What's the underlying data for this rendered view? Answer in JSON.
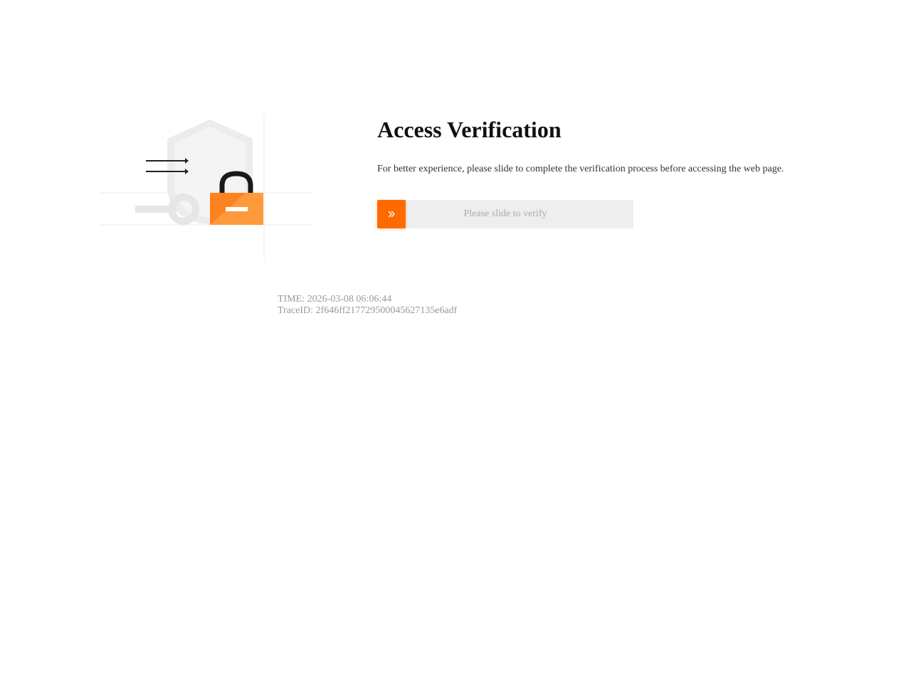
{
  "page": {
    "title": "Access Verification",
    "description": "For better experience, please slide to complete the verification process before accessing the web page."
  },
  "slider": {
    "placeholder": "Please slide to verify",
    "handle_icon": "double-chevron-right-icon",
    "progress": 0
  },
  "footer": {
    "time_label": "TIME: 2026-03-08 06:06:44",
    "trace_label": "TraceID: 2f646ff21772950004562713​5e6adf"
  },
  "illustration": {
    "icons": [
      "shield-icon",
      "lock-icon",
      "arrows-icon",
      "key-icon"
    ]
  },
  "colors": {
    "accent": "#ff6a00",
    "accent_light": "#ff9a3c",
    "slider_track": "#eeeeee",
    "muted_text": "#999999",
    "title_text": "#111111"
  }
}
